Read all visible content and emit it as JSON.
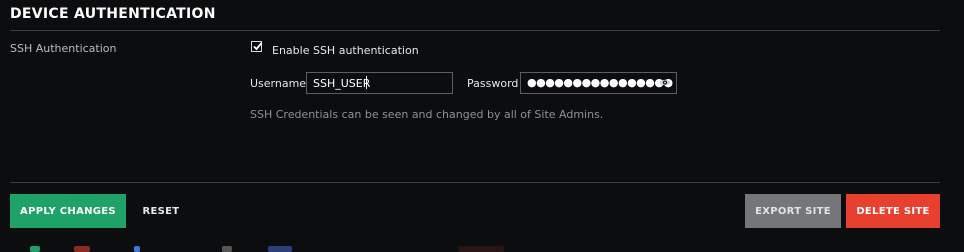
{
  "section": {
    "title": "DEVICE AUTHENTICATION"
  },
  "ssh": {
    "row_label": "SSH Authentication",
    "enable_label": "Enable SSH authentication",
    "enabled": true,
    "username_label": "Username",
    "username_value": "SSH_USER",
    "password_label": "Password",
    "password_masked": "●●●●●●●●●●●●●●●●",
    "note": "SSH Credentials can be seen and changed by all of Site Admins."
  },
  "actions": {
    "apply": "APPLY CHANGES",
    "reset": "RESET",
    "export": "EXPORT SITE",
    "delete": "DELETE SITE"
  },
  "colors": {
    "apply": "#1fa267",
    "delete": "#e8402e",
    "export": "#747679",
    "background": "#0c0d0f"
  },
  "icons": {
    "checkbox": "checkmark-icon",
    "password_toggle": "eye-icon"
  }
}
